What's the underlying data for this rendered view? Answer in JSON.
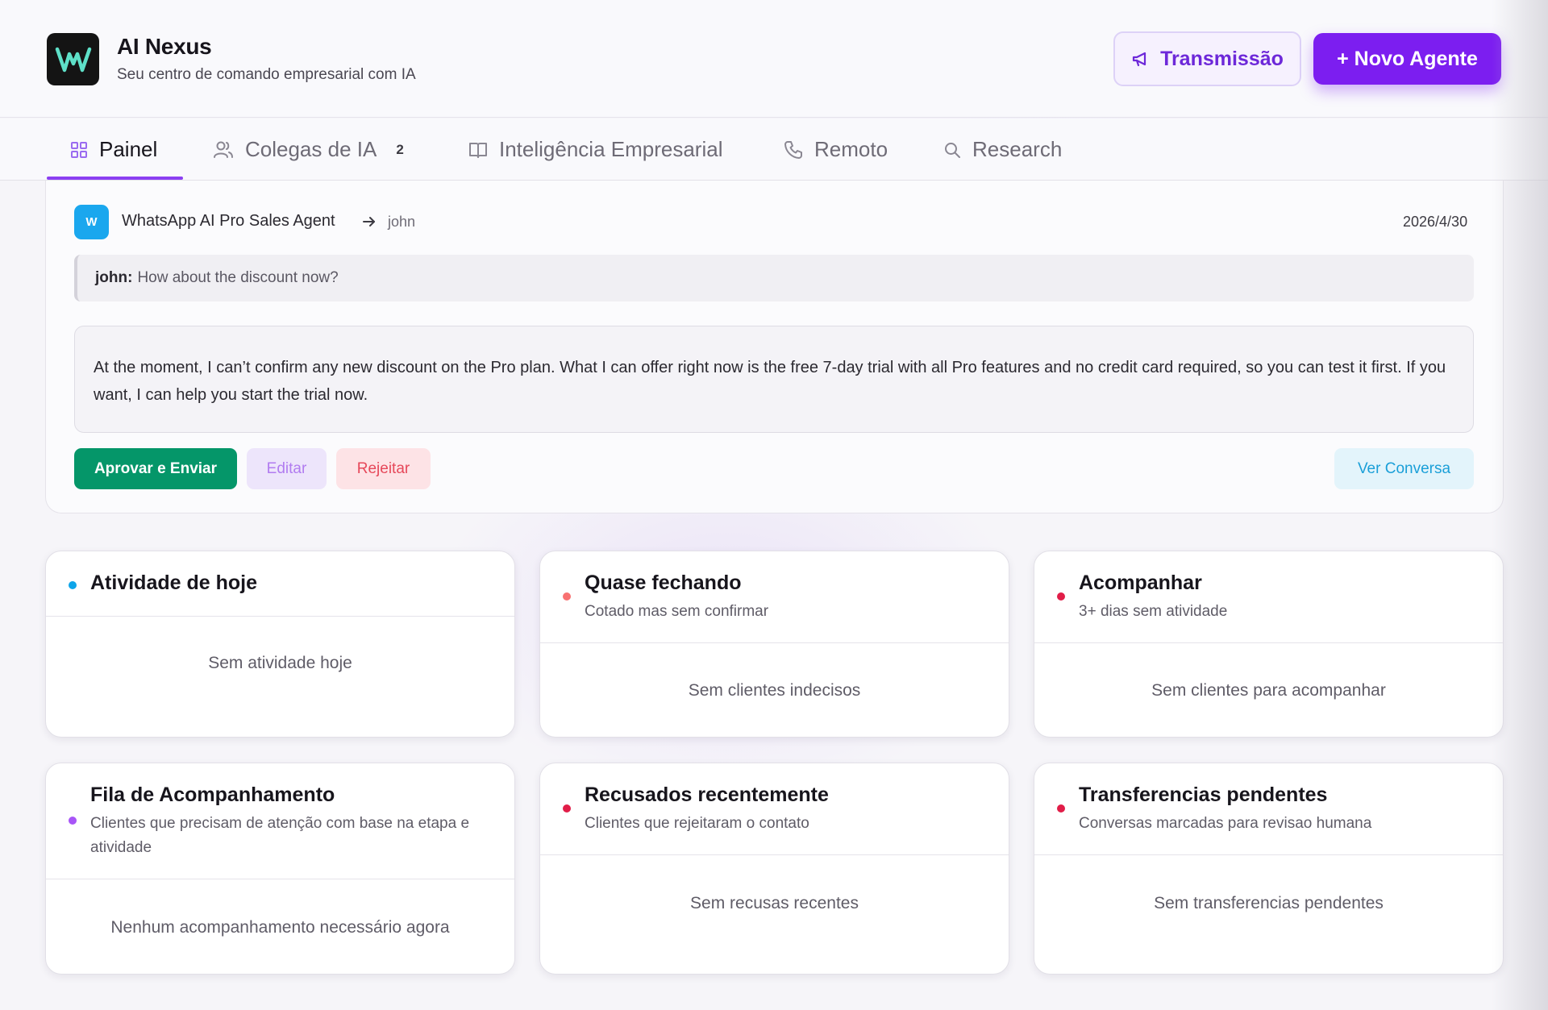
{
  "header": {
    "brand_title": "AI Nexus",
    "brand_subtitle": "Seu centro de comando empresarial com IA",
    "broadcast_label": "Transmissão",
    "new_agent_label": "+ Novo Agente",
    "logo_icon": "waveform-w-logo",
    "logo_color": "#5ee0c8",
    "accent_color": "#7c1ef0"
  },
  "tabs": [
    {
      "label": "Painel",
      "icon": "grid-icon",
      "active": true
    },
    {
      "label": "Colegas de IA",
      "icon": "users-icon",
      "badge": "2"
    },
    {
      "label": "Inteligência Empresarial",
      "icon": "book-open-icon"
    },
    {
      "label": "Remoto",
      "icon": "phone-icon"
    },
    {
      "label": "Research",
      "icon": "search-icon"
    }
  ],
  "approval": {
    "agent_initial": "W",
    "agent_name": "WhatsApp AI Pro Sales Agent",
    "recipient": "john",
    "date": "2026/4/30",
    "incoming_sender": "john:",
    "incoming_text": "How about the discount now?",
    "reply_text": "At the moment, I can’t confirm any new discount on the Pro plan. What I can offer right now is the free 7-day trial with all Pro features and no credit card required, so you can test it first. If you want, I can help you start the trial now.",
    "approve_label": "Aprovar e Enviar",
    "edit_label": "Editar",
    "reject_label": "Rejeitar",
    "view_label": "Ver Conversa"
  },
  "cards": [
    {
      "title": "Atividade de hoje",
      "subtitle": "",
      "empty": "Sem atividade hoje",
      "dot_color": "#0ea5e9"
    },
    {
      "title": "Quase fechando",
      "subtitle": "Cotado mas sem confirmar",
      "empty": "Sem clientes indecisos",
      "dot_color": "#f87171"
    },
    {
      "title": "Acompanhar",
      "subtitle": "3+ dias sem atividade",
      "empty": "Sem clientes para acompanhar",
      "dot_color": "#e11d48"
    },
    {
      "title": "Fila de Acompanhamento",
      "subtitle": "Clientes que precisam de atenção com base na etapa e atividade",
      "empty": "Nenhum acompanhamento necessário agora",
      "dot_color": "#a855f7"
    },
    {
      "title": "Recusados recentemente",
      "subtitle": "Clientes que rejeitaram o contato",
      "empty": "Sem recusas recentes",
      "dot_color": "#e11d48"
    },
    {
      "title": "Transferencias pendentes",
      "subtitle": "Conversas marcadas para revisao humana",
      "empty": "Sem transferencias pendentes",
      "dot_color": "#e11d48"
    }
  ]
}
